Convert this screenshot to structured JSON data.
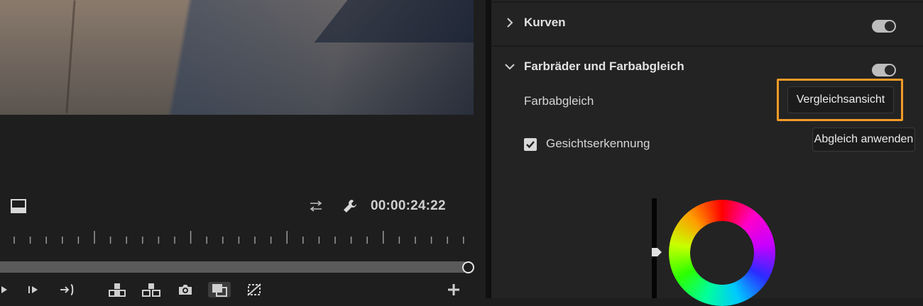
{
  "monitor": {
    "timecode": "00:00:24:22",
    "icons": [
      "export-frame-icon",
      "swap-icon",
      "wrench-icon"
    ],
    "transport": [
      "step-back-icon",
      "step-forward-icon",
      "go-to-out-icon",
      "lift-icon",
      "extract-icon",
      "camera-icon",
      "comparison-view-icon",
      "proxy-toggle-icon",
      "add-button-icon"
    ]
  },
  "panel": {
    "sections": [
      {
        "title": "Kurven",
        "expanded": false
      },
      {
        "title": "Farbräder und Farbabgleich",
        "expanded": true
      }
    ],
    "farbabgleich_label": "Farbabgleich",
    "compare_button": "Vergleichsansicht",
    "apply_button": "Abgleich anwenden",
    "face_detection_label": "Gesichtserkennung",
    "face_detection_checked": true
  },
  "colors": {
    "highlight": "#f39a27",
    "panel_bg": "#232323",
    "monitor_bg": "#1e1e1e"
  }
}
